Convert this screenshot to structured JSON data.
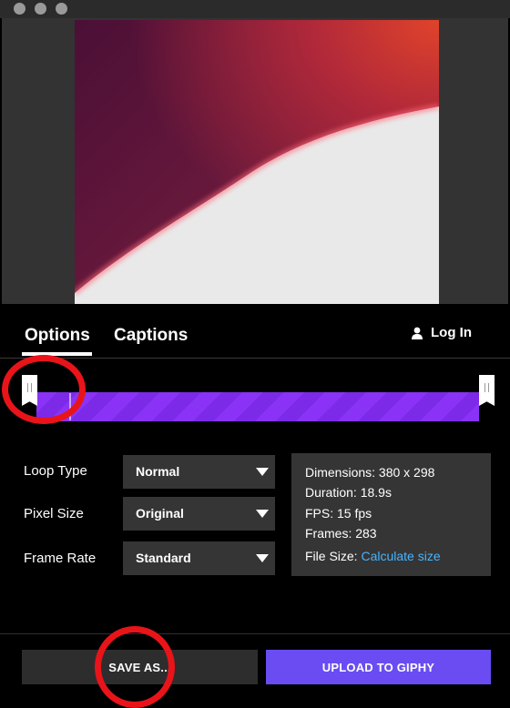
{
  "tabs": {
    "options_label": "Options",
    "captions_label": "Captions"
  },
  "account": {
    "login_label": "Log In"
  },
  "trim": {
    "start_fraction": 0.0,
    "end_fraction": 1.0
  },
  "settings": {
    "loop_type": {
      "label": "Loop Type",
      "value": "Normal"
    },
    "pixel_size": {
      "label": "Pixel Size",
      "value": "Original"
    },
    "frame_rate": {
      "label": "Frame Rate",
      "value": "Standard"
    }
  },
  "info": {
    "dimensions": "Dimensions: 380 x 298",
    "duration": "Duration: 18.9s",
    "fps": "FPS: 15 fps",
    "frames": "Frames: 283",
    "file_size_label": "File Size:",
    "file_size_link": "Calculate size"
  },
  "footer": {
    "save_as_label": "SAVE AS...",
    "upload_label": "UPLOAD TO GIPHY"
  },
  "icons": {
    "user": "user-icon",
    "caret": "caret-down-icon"
  },
  "colors": {
    "accent_purple": "#6a4cf2",
    "trim_purple": "#8a33f6",
    "link_blue": "#46b4ff",
    "annotation_red": "#e8141a"
  }
}
